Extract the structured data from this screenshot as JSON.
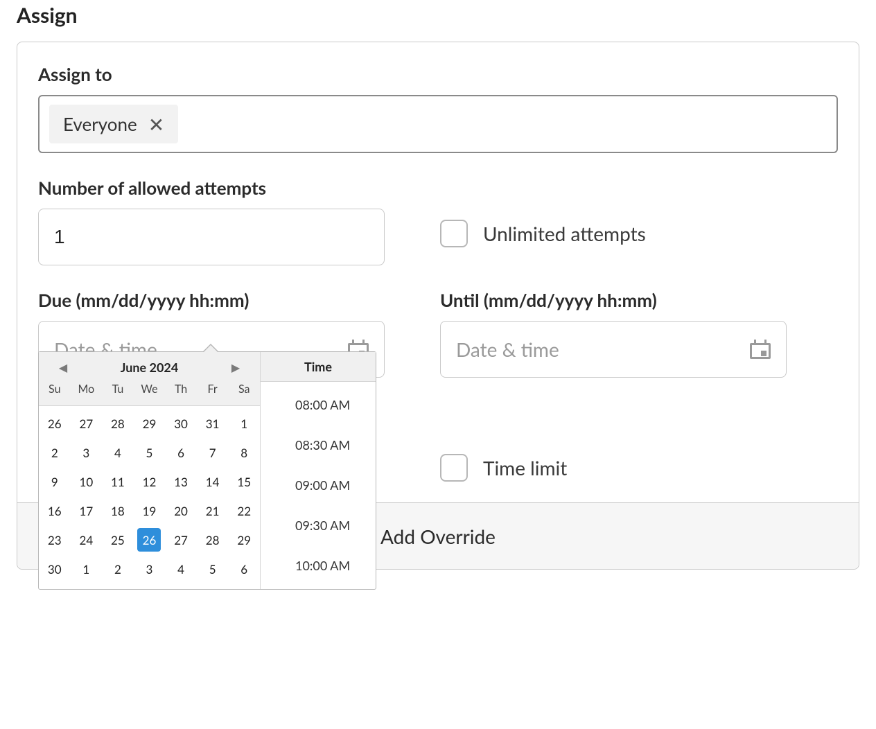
{
  "section_title": "Assign",
  "assign_to_label": "Assign to",
  "assign_to_tag": "Everyone",
  "attempts": {
    "label": "Number of allowed attempts",
    "value": "1",
    "unlimited_label": "Unlimited attempts"
  },
  "due": {
    "label": "Due (mm/dd/yyyy hh:mm)",
    "placeholder": "Date & time"
  },
  "until": {
    "label": "Until (mm/dd/yyyy hh:mm)",
    "placeholder": "Date & time"
  },
  "time_limit_label": "Time limit",
  "add_override_label": "Add Override",
  "datepicker": {
    "month": "June 2024",
    "time_header": "Time",
    "dow": [
      "Su",
      "Mo",
      "Tu",
      "We",
      "Th",
      "Fr",
      "Sa"
    ],
    "weeks": [
      [
        "26",
        "27",
        "28",
        "29",
        "30",
        "31",
        "1"
      ],
      [
        "2",
        "3",
        "4",
        "5",
        "6",
        "7",
        "8"
      ],
      [
        "9",
        "10",
        "11",
        "12",
        "13",
        "14",
        "15"
      ],
      [
        "16",
        "17",
        "18",
        "19",
        "20",
        "21",
        "22"
      ],
      [
        "23",
        "24",
        "25",
        "26",
        "27",
        "28",
        "29"
      ],
      [
        "30",
        "1",
        "2",
        "3",
        "4",
        "5",
        "6"
      ]
    ],
    "selected_day": "26",
    "selected_week_index": 4,
    "times": [
      "08:00 AM",
      "08:30 AM",
      "09:00 AM",
      "09:30 AM",
      "10:00 AM"
    ]
  }
}
